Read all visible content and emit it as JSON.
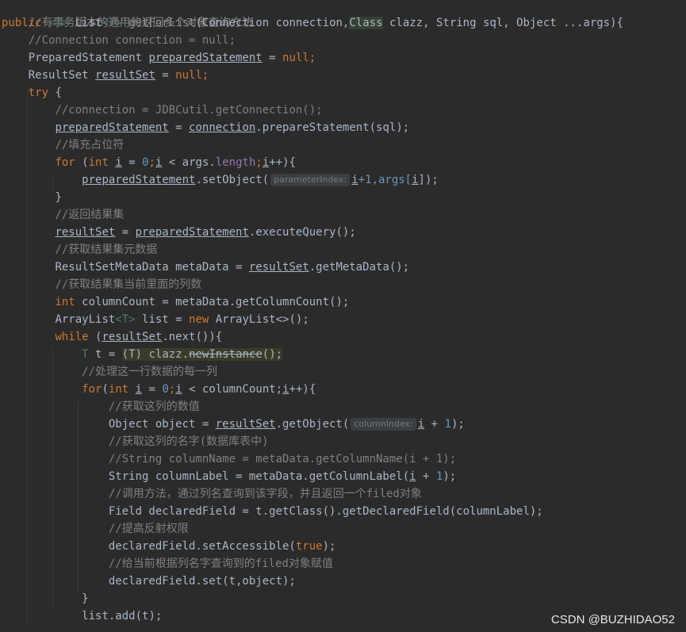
{
  "code": {
    "comment_top": "//有事务版本的通用的返回多个对象查询方法",
    "kw_public": "public",
    "type_T": "<T>",
    "list_type": " List",
    "method_name": "getForList",
    "params_a": "(Connection connection,",
    "param_class": "Class",
    "params_b": " clazz, String sql, Object ...args){",
    "comment_conn_null": "//Connection connection = null;",
    "ps_decl_type": "PreparedStatement ",
    "ps_var": "preparedStatement",
    "assign": " = ",
    "null_kw": "null",
    "semicolon": ";",
    "rs_decl_type": "ResultSet ",
    "rs_var": "resultSet",
    "kw_try": "try",
    "brace_open": " {",
    "comment_jdbc": "//connection = JDBCutil.getConnection();",
    "connection_var": "connection",
    "prepare_call": ".prepareStatement(sql);",
    "comment_fill": "//填充占位符",
    "kw_for": "for",
    "paren_open": " (",
    "kw_int": "int",
    "var_i": "i",
    "num_0": "0",
    "loop_cond_args": " < args.",
    "length_field": "length",
    "loop_end": "++){",
    "setobject_call": ".setObject(",
    "hint_parameterIndex": "parameterIndex:",
    "i_plus_1": "+1,args[",
    "close_call": "]);",
    "brace_close": "}",
    "comment_return_rs": "//返回结果集",
    "execute_query": ".executeQuery();",
    "comment_get_meta": "//获取结果集元数据",
    "meta_decl": "ResultSetMetaData metaData = ",
    "get_meta_call": ".getMetaData();",
    "comment_col_count": "//获取结果集当前里面的列数",
    "col_count_decl": " columnCount = metaData.getColumnCount();",
    "arraylist_decl_a": "ArrayList",
    "arraylist_decl_b": " list = ",
    "kw_new": "new",
    "arraylist_new": " ArrayList<>();",
    "kw_while": "while",
    "next_call": ".next()){",
    "T_var": "T",
    "t_assign": " t = ",
    "cast_T": "(T)",
    "clazz_dot": " clazz.",
    "new_instance": "newInstance",
    "new_instance_end": "();",
    "comment_each_row": "//处理这一行数据的每一列",
    "for_open": "(",
    "loop_cond_col": " < columnCount;",
    "comment_get_value": "//获取这列的数值",
    "object_decl": "Object object = ",
    "get_object_call": ".getObject(",
    "hint_columnIndex": "columnIndex:",
    "plus_1": " + ",
    "num_1": "1",
    "close_paren_semi": ");",
    "comment_get_name": "//获取这列的名字(数据库表中)",
    "comment_col_name": "//String columnName = metaData.getColumnName(i + 1);",
    "col_label_decl": "String columnLabel = metaData.getColumnLabel(",
    "comment_reflect": "//调用方法，通过列名查询到该字段，并且返回一个filed对象",
    "field_decl": "Field declaredField = t.getClass().getDeclaredField(columnLabel);",
    "comment_access": "//提高反射权限",
    "set_accessible": "declaredField.setAccessible(",
    "true_kw": "true",
    "comment_assign": "//给当前根据列名字查询到的filed对象赋值",
    "field_set": "declaredField.set(t,object);",
    "list_add": "list.add(t);"
  },
  "watermark": "CSDN @BUZHIDAO52"
}
